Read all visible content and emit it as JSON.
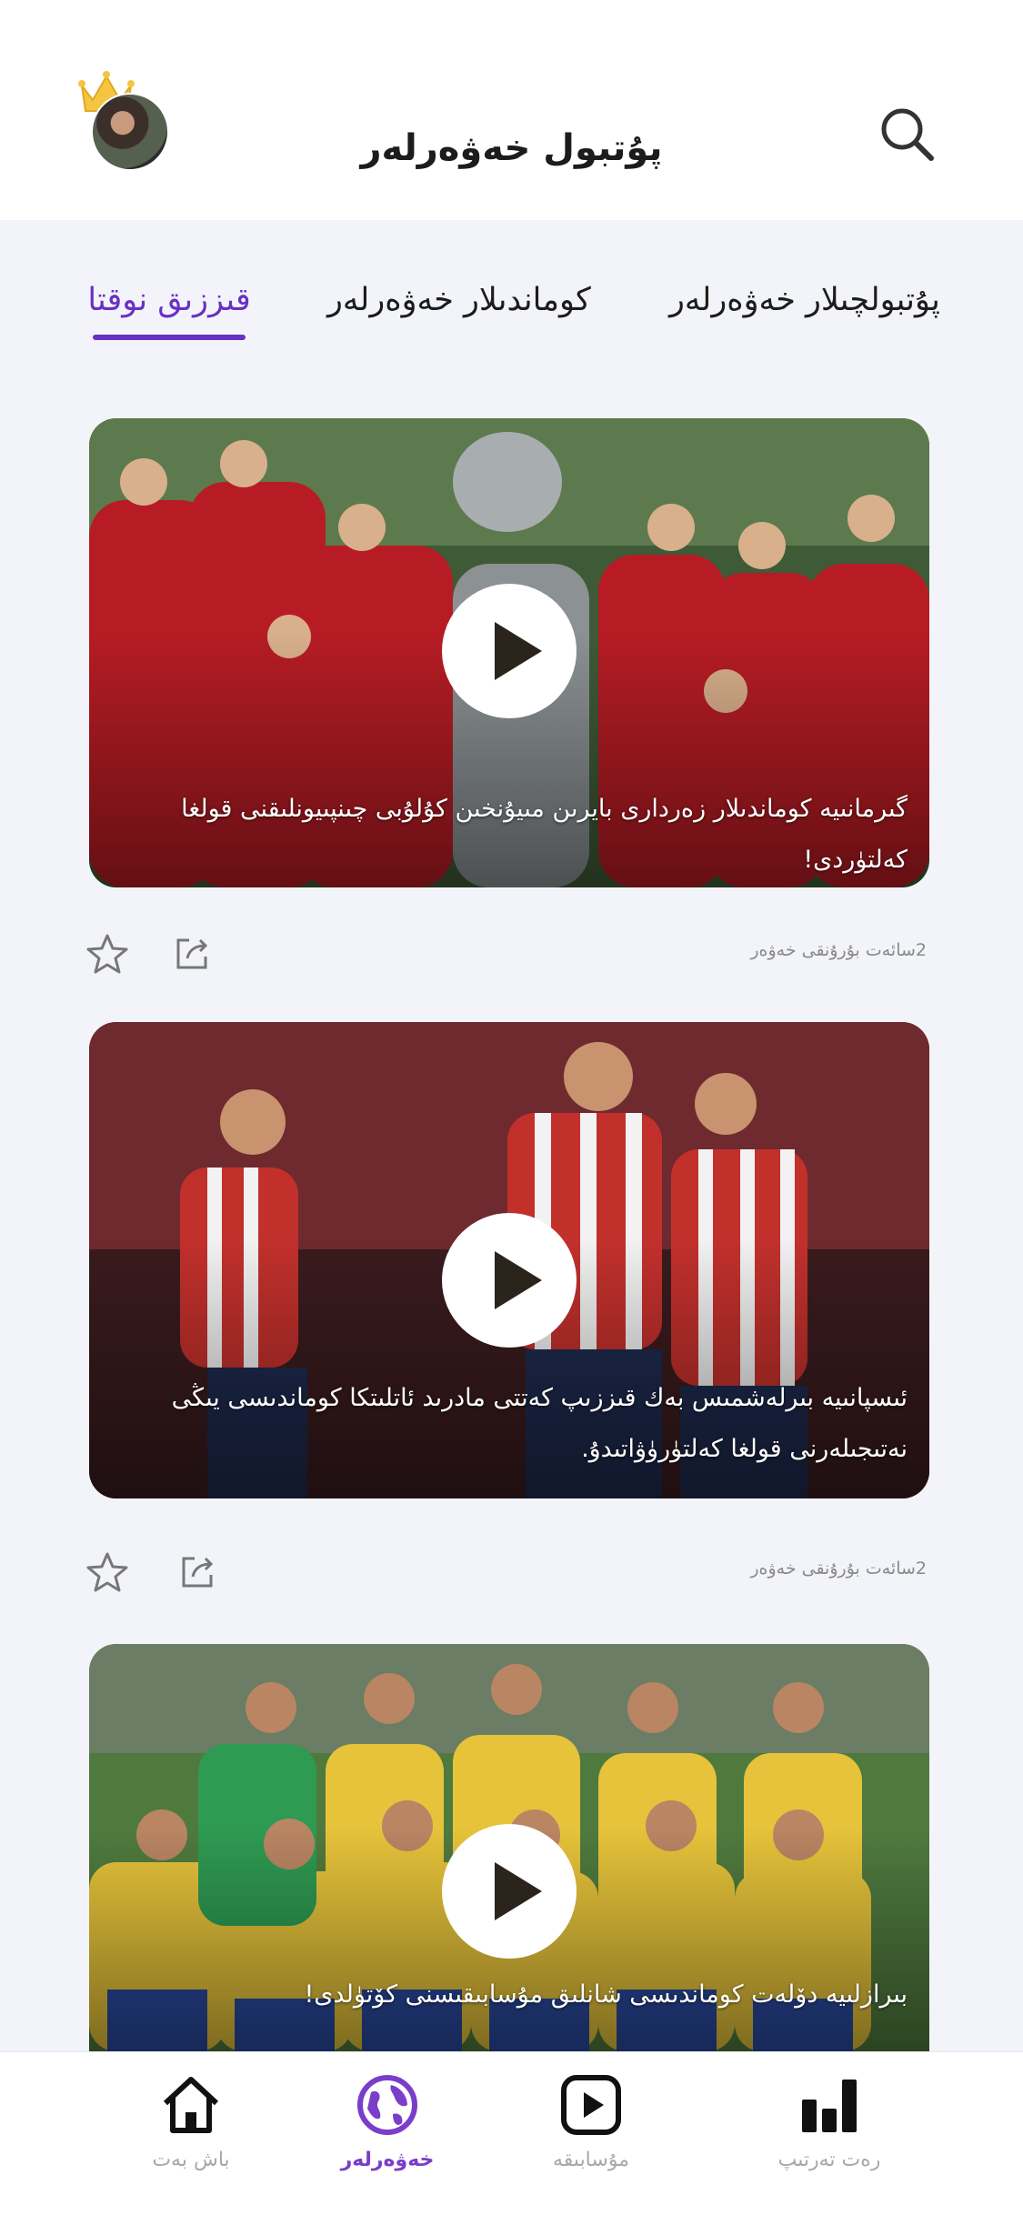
{
  "header": {
    "title": "پۇتبول خەۋەرلەر",
    "avatar_icon": "crown-avatar",
    "search_icon": "search-icon"
  },
  "tabs": [
    {
      "label": "پۇتبولچىلار خەۋەرلەر",
      "active": false
    },
    {
      "label": "كوماندىلار خەۋەرلەر",
      "active": false
    },
    {
      "label": "قىززىق نوقتا",
      "active": true
    }
  ],
  "accent_color": "#6a2fc4",
  "feed": [
    {
      "caption": "گىرمانىيە كوماندىلار زەردارى بايرىن مىيۇنخىن كۇلۇبى چىنپىيونلىقنى قولغا كەلتۈردى!",
      "time": "2سائەت بۇرۇنقى خەۋەر"
    },
    {
      "caption": "ئىسپانىيە بىرلەشمىس بەك قىززىپ كەتتى مادرىد ئاتلىتكا كوماندىسى يىڭى نەتىجىلەرنى قولغا كەلتۈرۈۋاتىدۇ.",
      "time": "2سائەت بۇرۇنقى خەۋەر"
    },
    {
      "caption": "بىرازلىيە دۆلەت كوماندىسى شانلىق مۇسابىقىسنى كۆتۈلدى!",
      "time": ""
    }
  ],
  "bottom_nav": [
    {
      "label": "باش بەت",
      "icon": "home-icon",
      "active": false
    },
    {
      "label": "خەۋەرلەر",
      "icon": "globe-icon",
      "active": true
    },
    {
      "label": "مۇسابىقە",
      "icon": "play-icon",
      "active": false
    },
    {
      "label": "رەت تەرتىپ",
      "icon": "ranking-bars-icon",
      "active": false
    }
  ]
}
